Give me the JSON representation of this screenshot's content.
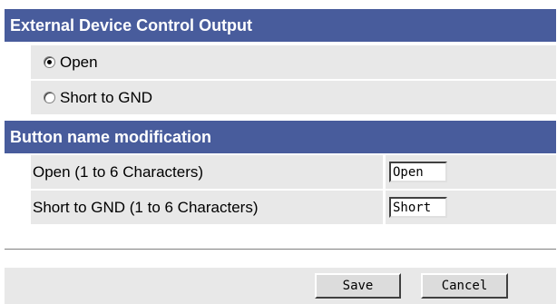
{
  "output_section": {
    "title": "External Device Control Output",
    "options": [
      {
        "label": "Open",
        "selected": true
      },
      {
        "label": "Short to GND",
        "selected": false
      }
    ]
  },
  "name_section": {
    "title": "Button name modification",
    "fields": [
      {
        "label": "Open (1 to 6 Characters)",
        "value": "Open"
      },
      {
        "label": "Short to GND (1 to 6 Characters)",
        "value": "Short"
      }
    ]
  },
  "buttons": {
    "save_label": "Save",
    "cancel_label": "Cancel"
  },
  "colors": {
    "header_bg": "#485c9c",
    "row_bg": "#e8e8e8"
  }
}
